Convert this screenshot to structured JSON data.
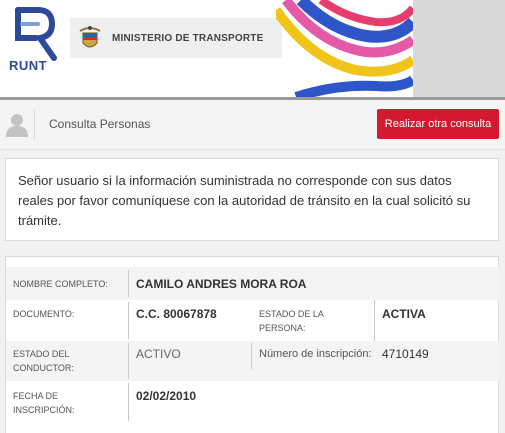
{
  "header": {
    "runt_logo_text": "RUNT",
    "ministry_name": "MINISTERIO DE TRANSPORTE"
  },
  "toolbar": {
    "title": "Consulta Personas",
    "action_button": "Realizar otra consulta"
  },
  "notice": {
    "text": "Señor usuario si la información suministrada no corresponde con sus datos reales por favor comuníquese con la autoridad de tránsito en la cual solicitó su trámite."
  },
  "person": {
    "full_name_label": "NOMBRE COMPLETO:",
    "full_name": "CAMILO ANDRES MORA ROA",
    "document_label": "DOCUMENTO:",
    "document": "C.C. 80067878",
    "person_status_label": "ESTADO DE LA PERSONA:",
    "person_status": "ACTIVA",
    "driver_status_label": "ESTADO DEL CONDUCTOR:",
    "driver_status": "ACTIVO",
    "registration_number_label": "Número de inscripción:",
    "registration_number": "4710149",
    "registration_date_label": "FECHA DE INSCRIPCIÓN:",
    "registration_date": "02/02/2010"
  },
  "colors": {
    "accent_red": "#d3192f",
    "runt_blue": "#2d4a9a"
  }
}
